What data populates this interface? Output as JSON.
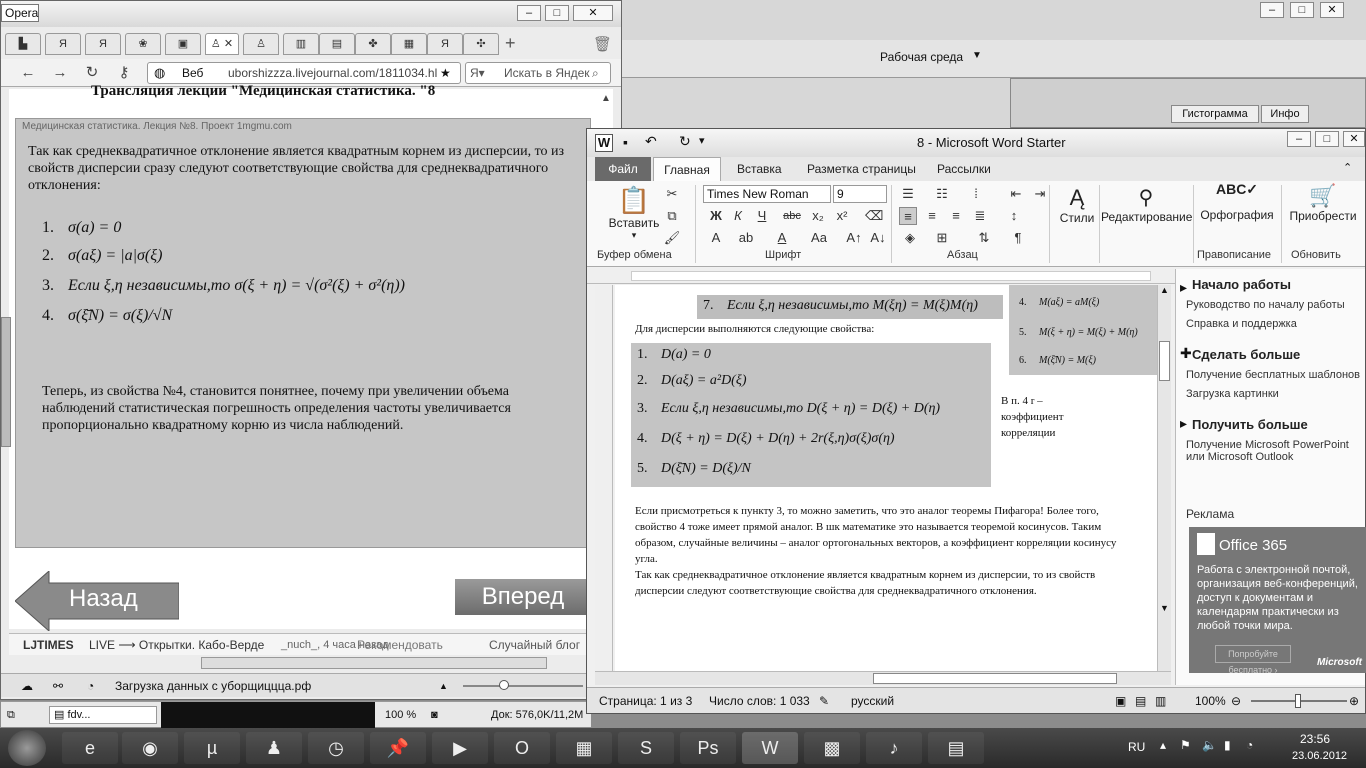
{
  "background": {
    "workspace_label": "Рабочая среда",
    "dialog_tabs": [
      "Гистограмма",
      "Инфо"
    ]
  },
  "opera": {
    "title": "Opera",
    "address_prefix": "Веб",
    "url": "uborshizzza.livejournal.com/1811034.hl",
    "search_placeholder": "Искать в Яндек",
    "lecture_title": "Трансляция лекции \"Медицинская статистика. \"8",
    "slide": {
      "caption": "Медицинская статистика. Лекция №8. Проект 1mgmu.com",
      "intro": "Так как среднеквадратичное отклонение является квадратным корнем из дисперсии, то из свойств дисперсии сразу следуют соответствующие свойства для среднеквадратичного отклонения:",
      "formulas": [
        {
          "n": "1.",
          "f": "σ(a) = 0"
        },
        {
          "n": "2.",
          "f": "σ(aξ) = |a|σ(ξ)"
        },
        {
          "n": "3.",
          "f": "Если ξ,η независимы,то σ(ξ + η) = √(σ²(ξ) + σ²(η))"
        },
        {
          "n": "4.",
          "f": "σ(ξ̄N) = σ(ξ)/√N"
        }
      ],
      "conclusion": "Теперь, из свойства №4, становится понятнее, почему при увеличении объема наблюдений статистическая погрешность определения частоты увеличивается пропорционально квадратному корню из числа наблюдений."
    },
    "back_label": "Назад",
    "forward_label": "Вперед",
    "lj_bar": {
      "brand": "LJTIMES",
      "live": "LIVE ⟶ Открытки. Кабо-Верде",
      "user": "_nuch_, 4 часа назад",
      "recommend": "Рекомендовать",
      "random": "Случайный блог"
    },
    "status": "Загрузка данных с уборщиццца.рф",
    "zoom": "100 %",
    "doc_info": "Док: 576,0K/11,2M",
    "task_label": "fdv..."
  },
  "word": {
    "title": "8  -  Microsoft Word Starter",
    "tabs": [
      "Файл",
      "Главная",
      "Вставка",
      "Разметка страницы",
      "Рассылки"
    ],
    "font_name": "Times New Roman",
    "font_size": "9",
    "paste_label": "Вставить",
    "styles_label": "Стили",
    "editing_label": "Редактирование",
    "spelling_label": "Орфография",
    "buy_label": "Приобрести",
    "groups": [
      "Буфер обмена",
      "Шрифт",
      "Абзац",
      "Правописание",
      "Обновить"
    ],
    "doc": {
      "top_formula": {
        "n": "7.",
        "f": "Если ξ,η независимы,то M(ξη) = M(ξ)M(η)"
      },
      "side_formulas": [
        {
          "n": "4.",
          "f": "M(aξ) = aM(ξ)"
        },
        {
          "n": "5.",
          "f": "M(ξ + η) = M(ξ) + M(η)"
        },
        {
          "n": "6.",
          "f": "M(ξ̄N) = M(ξ)"
        }
      ],
      "dispersion_intro": "Для дисперсии  выполняются следующие свойства:",
      "dispersion_formulas": [
        {
          "n": "1.",
          "f": "D(a) = 0"
        },
        {
          "n": "2.",
          "f": "D(aξ) = a²D(ξ)"
        },
        {
          "n": "3.",
          "f": "Если ξ,η независимы,то D(ξ + η) = D(ξ) + D(η)"
        },
        {
          "n": "4.",
          "f": "D(ξ + η) = D(ξ) + D(η) + 2r(ξ,η)σ(ξ)σ(η)"
        },
        {
          "n": "5.",
          "f": "D(ξ̄N) = D(ξ)/N"
        }
      ],
      "side_note": "В п. 4 r – коэффициент корреляции",
      "paragraph1": "Если присмотреться к пункту 3, то можно заметить, что это аналог теоремы Пифагора! Более того, свойство 4 тоже имеет прямой аналог. В шк математике это называется теоремой косинусов. Таким образом, случайные величины – аналог ортогональных векторов, а коэффициент корреляции косинусу угла.",
      "paragraph2": "Так как среднеквадратичное  отклонение является квадратным корнем из дисперсии,  то из свойств дисперсии следуют соответствующие свойства для среднеквадратичного отклонения."
    },
    "pane": {
      "h1": "Начало работы",
      "l1": "Руководство по началу работы",
      "l2": "Справка и поддержка",
      "h2": "Сделать больше",
      "l3": "Получение бесплатных шаблонов",
      "l4": "Загрузка картинки",
      "h3": "Получить больше",
      "l5": "Получение Microsoft PowerPoint или Microsoft Outlook",
      "ad_label": "Реклама",
      "ad_brand": "Office 365",
      "ad_text": "Работа с электронной почтой, организация веб-конференций, доступ к документам и календарям практически из любой точки мира.",
      "ad_button": "Попробуйте бесплатно ›",
      "ad_ms": "Microsoft"
    },
    "status": {
      "page": "Страница: 1 из 3",
      "words": "Число слов: 1 033",
      "lang": "русский",
      "zoom": "100%"
    }
  },
  "taskbar": {
    "lang": "RU",
    "time": "23:56",
    "date": "23.06.2012"
  }
}
